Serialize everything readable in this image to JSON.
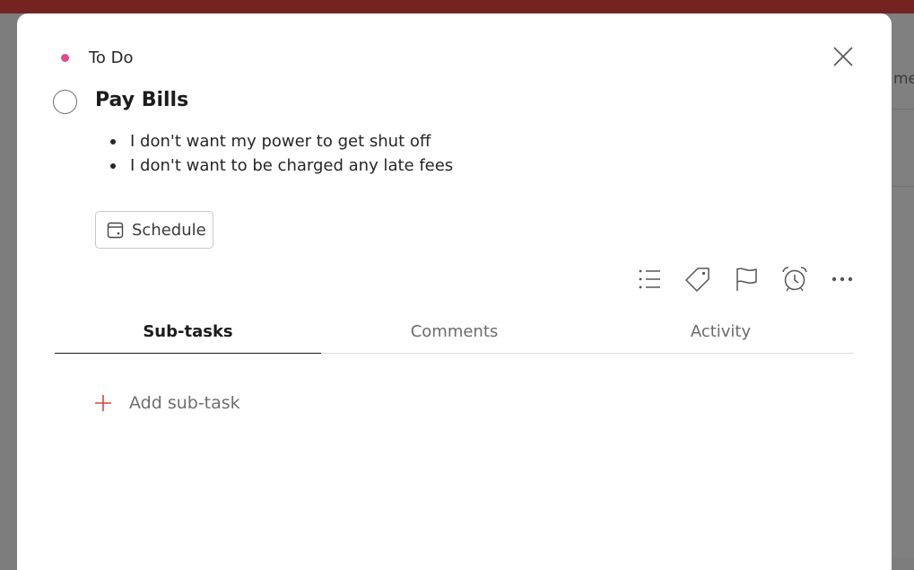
{
  "colors": {
    "project_dot": "#e14a8f",
    "add_icon": "#d9463a",
    "top_bar": "#742420"
  },
  "background": {
    "partial_text": "me"
  },
  "project": {
    "name": "To Do"
  },
  "task": {
    "title": "Pay Bills",
    "notes": [
      "I don't want my power to get shut off",
      "I don't want to be charged any late fees"
    ]
  },
  "schedule": {
    "label": "Schedule",
    "icon": "calendar-icon"
  },
  "toolbar": {
    "icons": [
      "list-icon",
      "tag-icon",
      "flag-icon",
      "alarm-icon",
      "more-icon"
    ]
  },
  "tabs": [
    {
      "label": "Sub-tasks",
      "active": true
    },
    {
      "label": "Comments",
      "active": false
    },
    {
      "label": "Activity",
      "active": false
    }
  ],
  "subtasks": {
    "add_label": "Add sub-task"
  }
}
